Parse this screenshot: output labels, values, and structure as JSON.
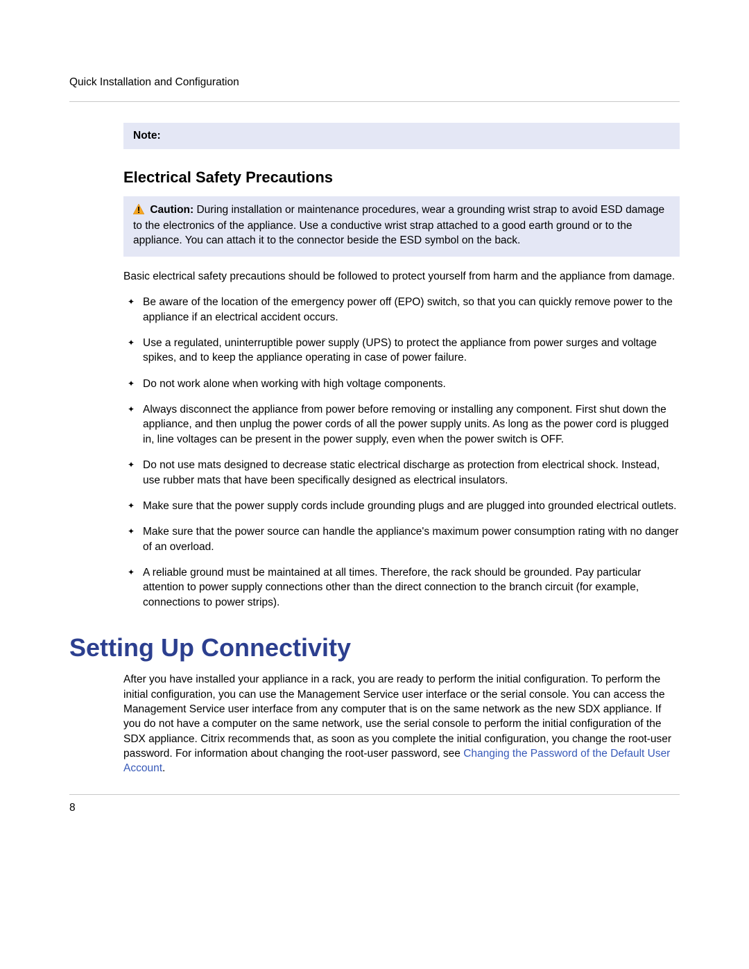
{
  "running_head": "Quick Installation and Configuration",
  "note_label": "Note:",
  "subhead": "Electrical Safety Precautions",
  "caution_label": "Caution:",
  "caution_text": " During installation or maintenance procedures, wear a grounding wrist strap to avoid ESD damage to the electronics of the appliance. Use a conductive wrist strap attached to a good earth ground or to the appliance. You can attach it to the connector beside the ESD symbol on the back.",
  "intro_para": "Basic electrical safety precautions should be followed to protect yourself from harm and the appliance from damage.",
  "bullets": [
    "Be aware of the location of the emergency power off (EPO) switch, so that you can quickly remove power to the appliance if an electrical accident occurs.",
    "Use a regulated, uninterruptible power supply (UPS) to protect the appliance from power surges and voltage spikes, and to keep the appliance operating in case of power failure.",
    "Do not work alone when working with high voltage components.",
    "Always disconnect the appliance from power before removing or installing any component. First shut down the appliance, and then unplug the power cords of all the power supply units. As long as the power cord is plugged in, line voltages can be present in the power supply, even when the power switch is OFF.",
    "Do not use mats designed to decrease static electrical discharge as protection from electrical shock. Instead, use rubber mats that have been specifically designed as electrical insulators.",
    "Make sure that the power supply cords include grounding plugs and are plugged into grounded electrical outlets.",
    "Make sure that the power source can handle the appliance's maximum power consumption rating with no danger of an overload.",
    "A reliable ground must be maintained at all times. Therefore, the rack should be grounded. Pay particular attention to power supply connections other than the direct connection to the branch circuit (for example, connections to power strips)."
  ],
  "section_head": "Setting Up Connectivity",
  "section_para_pre": "After you have installed your appliance in a rack, you are ready to perform the initial configuration. To perform the initial configuration, you can use the Management Service user interface or the serial console. You can access the Management Service user interface from any computer that is on the same network as the new SDX appliance. If you do not have a computer on the same network, use the serial console to perform the initial configuration of the SDX appliance. Citrix recommends that, as soon as you complete the initial configuration, you change the root-user password. For information about changing the root-user password, see ",
  "section_link": "Changing the Password of the Default User Account",
  "section_para_post": ".",
  "page_number": "8"
}
